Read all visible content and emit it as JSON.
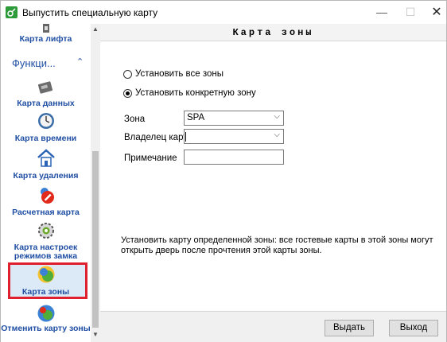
{
  "window": {
    "title": "Выпустить специальную карту",
    "controls": {
      "minimize": "—",
      "maximize": "☐",
      "close": "✕"
    }
  },
  "sidebar": {
    "top_item": {
      "label": "Карта лифта",
      "icon": "lift-card-icon"
    },
    "section": {
      "label": "Функци...",
      "chevron": "⌃"
    },
    "items": [
      {
        "label": "Карта данных",
        "icon": "data-card-icon"
      },
      {
        "label": "Карта времени",
        "icon": "clock-icon"
      },
      {
        "label": "Карта удаления",
        "icon": "house-icon"
      },
      {
        "label": "Расчетная карта",
        "icon": "settlement-card-icon"
      },
      {
        "label": "Карта настроек режимов замка",
        "label_line1": "Карта настроек",
        "label_line2": "режимов замка",
        "icon": "lock-settings-icon"
      },
      {
        "label": "Карта зоны",
        "icon": "zone-card-icon",
        "selected": true
      },
      {
        "label": "Отменить карту зоны",
        "icon": "cancel-zone-icon"
      }
    ]
  },
  "main": {
    "title": "Карта зоны",
    "radios": {
      "all_zones": {
        "label": "Установить все зоны",
        "checked": false
      },
      "specific_zone": {
        "label": "Установить конкретную зону",
        "checked": true
      }
    },
    "fields": {
      "zone": {
        "label": "Зона",
        "value": "SPA"
      },
      "owner": {
        "label": "Владелец карты",
        "value": ""
      },
      "note": {
        "label": "Примечание",
        "value": ""
      }
    },
    "info": "Установить карту определенной зоны: все гостевые карты в этой зоны могут открыть дверь после прочтения этой карты зоны.",
    "buttons": {
      "issue": "Выдать",
      "exit": "Выход"
    }
  },
  "colors": {
    "accent": "#1f4ea3",
    "selection_border": "#e0202f",
    "selection_fill": "#dceaf7"
  }
}
